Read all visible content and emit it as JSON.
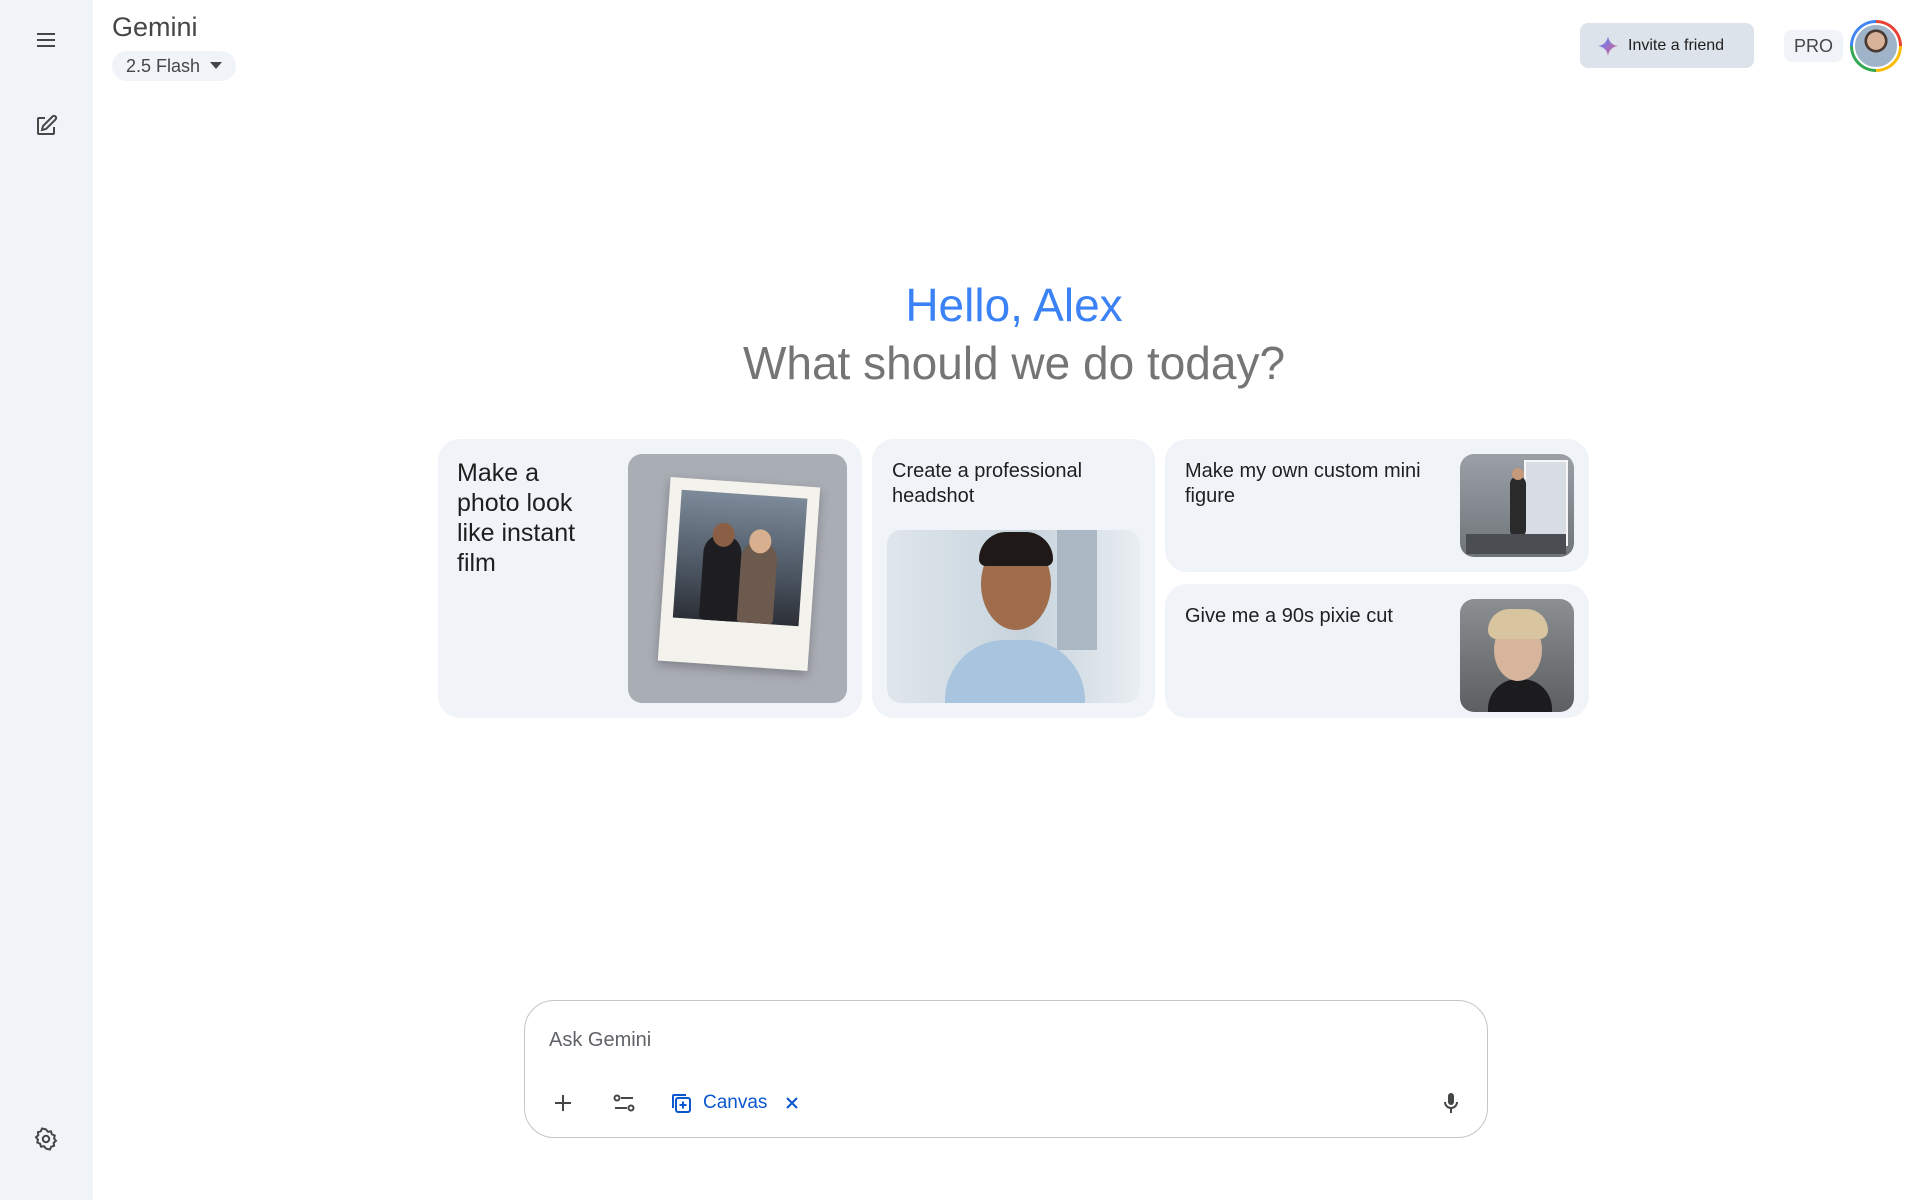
{
  "sidebar": {
    "menu_icon": "menu-icon",
    "new_chat_icon": "edit-icon",
    "settings_icon": "gear-icon"
  },
  "header": {
    "app_title": "Gemini",
    "model_selector": "2.5 Flash",
    "invite_label": "Invite a friend",
    "plan_badge": "PRO"
  },
  "greeting": {
    "hello": "Hello, Alex",
    "subtitle": "What should we do today?"
  },
  "suggestions": [
    {
      "label": "Make a photo look like instant film"
    },
    {
      "label": "Create a professional headshot"
    },
    {
      "label": "Make my own custom mini figure"
    },
    {
      "label": "Give me a 90s pixie cut"
    }
  ],
  "composer": {
    "placeholder": "Ask Gemini",
    "tool_chip": "Canvas"
  },
  "colors": {
    "accent": "#0b57d0",
    "greeting_blue": "#3b82f6",
    "rail": "#f0f4f9",
    "card": "#f0f4f9"
  }
}
